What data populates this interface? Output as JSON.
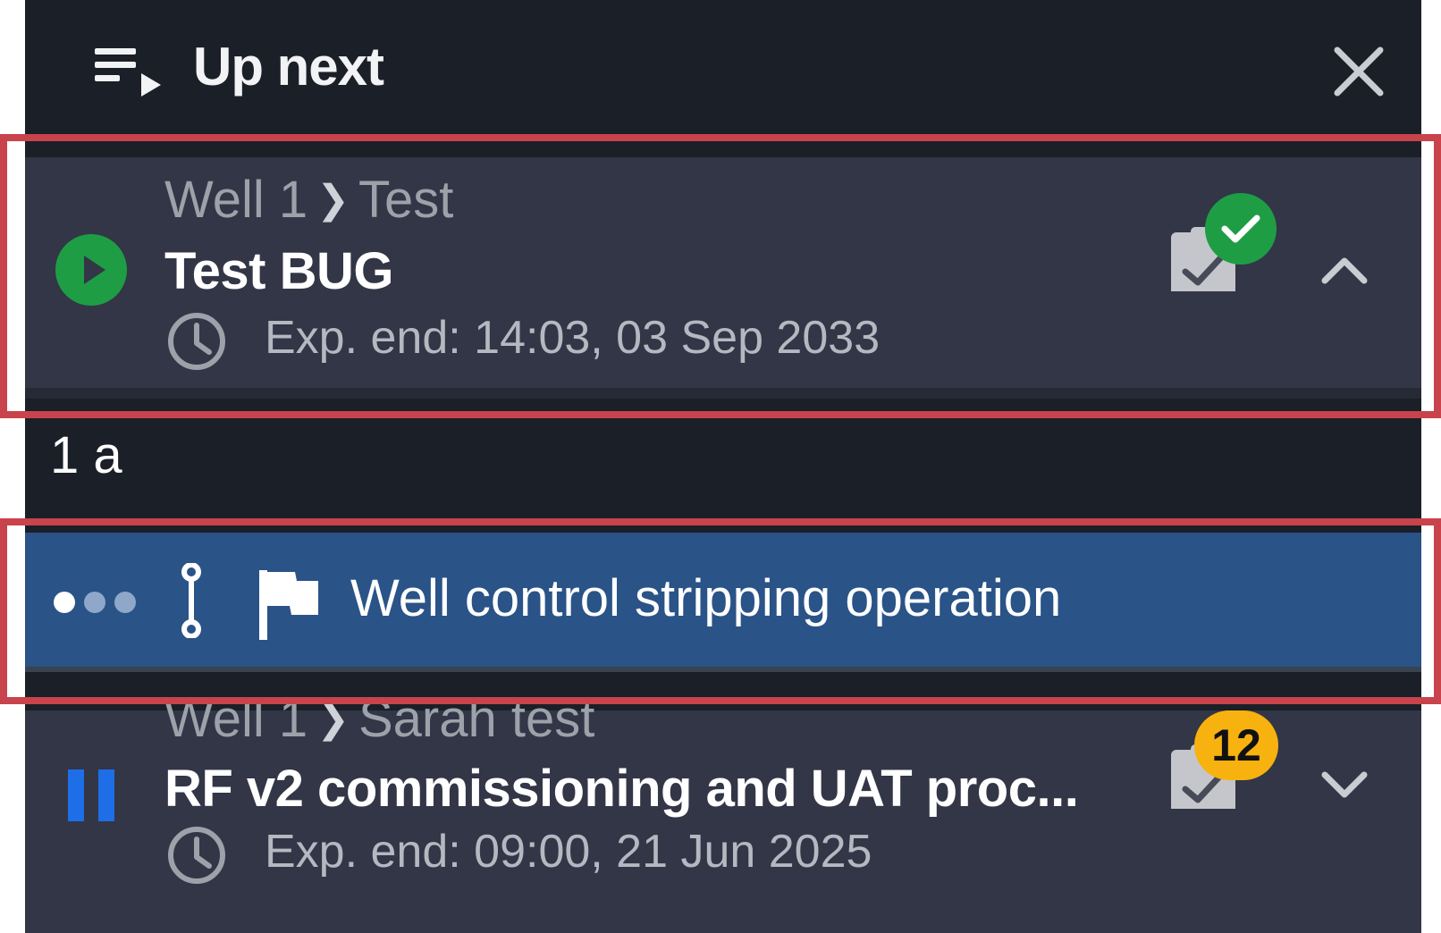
{
  "header": {
    "title": "Up next",
    "icon": "queue-play-icon",
    "close_icon": "close-icon"
  },
  "items": [
    {
      "status_icon": "play-circle-icon",
      "status_color": "#1f9d45",
      "crumb_well": "Well 1",
      "crumb_folder": "Test",
      "title": "Test BUG",
      "exp_end": "Exp. end: 14:03, 03 Sep 2033",
      "checklist_status": "complete",
      "expanded": true
    },
    {
      "status_icon": "pause-icon",
      "status_color": "#1e6ee8",
      "crumb_well": "Well 1",
      "crumb_folder": "Sarah test",
      "title": "RF v2 commissioning and UAT proc...",
      "exp_end": "Exp. end: 09:00, 21 Jun 2025",
      "checklist_count": "12",
      "expanded": false
    }
  ],
  "section_label": "1 a",
  "step": {
    "text": "Well control stripping operation",
    "icons": [
      "progress-dots-icon",
      "connector-icon",
      "flag-icon"
    ]
  },
  "colors": {
    "panel_bg": "#1b1f27",
    "card_bg": "#323646",
    "step_bg": "#2a5388",
    "highlight": "#c8434c",
    "badge": "#f7b20f",
    "complete_green": "#1f9d45"
  }
}
